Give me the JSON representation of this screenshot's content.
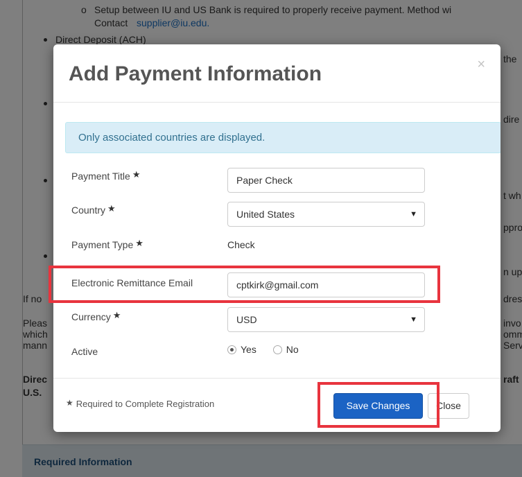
{
  "background": {
    "line1": "Setup between IU and US Bank is required to properly receive payment. Method wi",
    "contact_prefix": "Contact",
    "contact_email": "supplier@iu.edu.",
    "bullet_direct_deposit": "Direct Deposit (ACH)",
    "right_frag1": "the",
    "right_frag2": "dire",
    "right_frag3": "t wh",
    "right_frag4": "ppro",
    "right_frag5": "n up",
    "right_frag6": "dres",
    "right_frag7": "invo",
    "right_frag8": "omm",
    "right_frag9": "Serv",
    "right_frag10": "raft",
    "left_frag1": "If no",
    "left_frag2": "Pleas",
    "left_frag3": "which",
    "left_frag4": "mann",
    "left_frag5": "Direc",
    "left_frag6": "U.S.",
    "footer_heading": "Required Information"
  },
  "modal": {
    "title": "Add Payment Information",
    "close_symbol": "×",
    "alert": "Only associated countries are displayed.",
    "star": "★",
    "fields": {
      "payment_title": {
        "label": "Payment Title",
        "value": "Paper Check"
      },
      "country": {
        "label": "Country",
        "value": "United States"
      },
      "payment_type": {
        "label": "Payment Type",
        "value": "Check"
      },
      "remittance_email": {
        "label": "Electronic Remittance Email",
        "value": "cptkirk@gmail.com"
      },
      "currency": {
        "label": "Currency",
        "value": "USD"
      },
      "active": {
        "label": "Active",
        "options": [
          "Yes",
          "No"
        ],
        "selected": "Yes"
      }
    },
    "footer_note": "Required to Complete Registration",
    "save_label": "Save Changes",
    "close_label": "Close",
    "caret": "▼"
  },
  "colors": {
    "primary": "#1b63c4",
    "highlight": "#e8343e",
    "alert_bg": "#d9edf7",
    "alert_text": "#31708f"
  }
}
